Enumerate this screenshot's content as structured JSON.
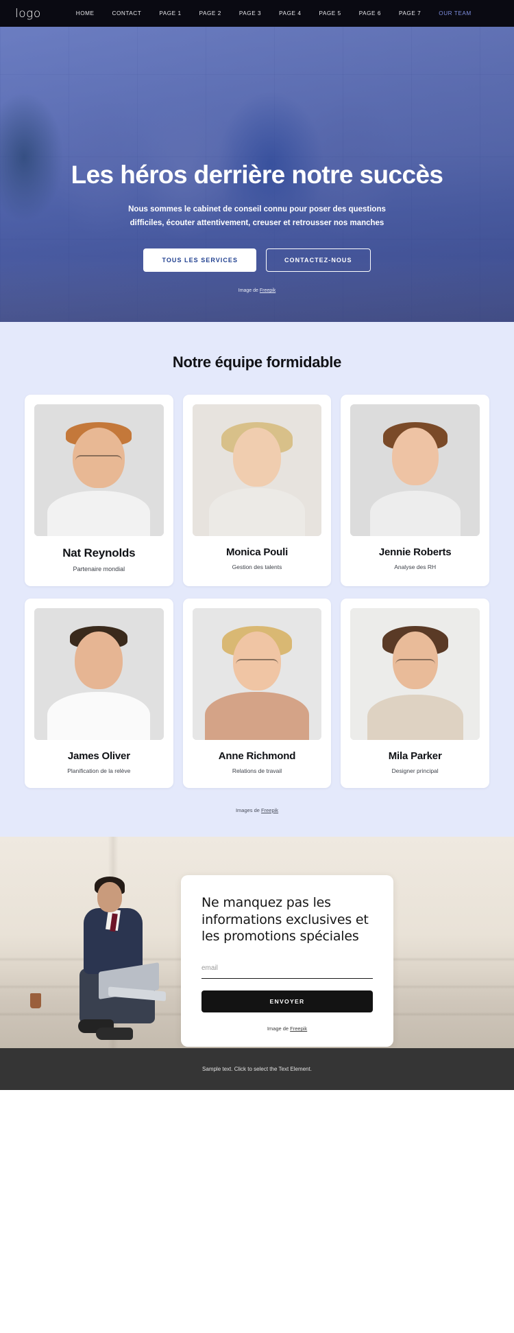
{
  "navbar": {
    "logo": "logo",
    "links": [
      {
        "label": "HOME",
        "active": false
      },
      {
        "label": "CONTACT",
        "active": false
      },
      {
        "label": "PAGE 1",
        "active": false
      },
      {
        "label": "PAGE 2",
        "active": false
      },
      {
        "label": "PAGE 3",
        "active": false
      },
      {
        "label": "PAGE 4",
        "active": false
      },
      {
        "label": "PAGE 5",
        "active": false
      },
      {
        "label": "PAGE 6",
        "active": false
      },
      {
        "label": "PAGE 7",
        "active": false
      },
      {
        "label": "OUR TEAM",
        "active": true
      }
    ],
    "bg_color": "#0a0a12",
    "active_color": "#7f8fe0"
  },
  "hero": {
    "title": "Les héros derrière notre succès",
    "subtitle": "Nous sommes le cabinet de conseil connu pour poser des questions difficiles, écouter attentivement, creuser et retrousser nos manches",
    "primary_button": "TOUS LES SERVICES",
    "secondary_button": "CONTACTEZ-NOUS",
    "credit_prefix": "Image de ",
    "credit_link": "Freepik",
    "overlay_color": "#2e46aa"
  },
  "team": {
    "heading": "Notre équipe formidable",
    "bg_color": "#e4e9fb",
    "credit_prefix": "Images de ",
    "credit_link": "Freepik",
    "members": [
      {
        "name": "Nat Reynolds",
        "role": "Partenaire mondial",
        "featured": true
      },
      {
        "name": "Monica Pouli",
        "role": "Gestion des talents",
        "featured": false
      },
      {
        "name": "Jennie Roberts",
        "role": "Analyse des RH",
        "featured": false
      },
      {
        "name": "James Oliver",
        "role": "Planification de la relève",
        "featured": false
      },
      {
        "name": "Anne Richmond",
        "role": "Relations de travail",
        "featured": false
      },
      {
        "name": "Mila Parker",
        "role": "Designer principal",
        "featured": false
      }
    ]
  },
  "newsletter": {
    "title": "Ne manquez pas les informations exclusives et les promotions spéciales",
    "email_placeholder": "email",
    "email_value": "",
    "submit_label": "ENVOYER",
    "credit_prefix": "Image de ",
    "credit_link": "Freepik"
  },
  "footer": {
    "text": "Sample text. Click to select the Text Element.",
    "bg_color": "#353535"
  }
}
